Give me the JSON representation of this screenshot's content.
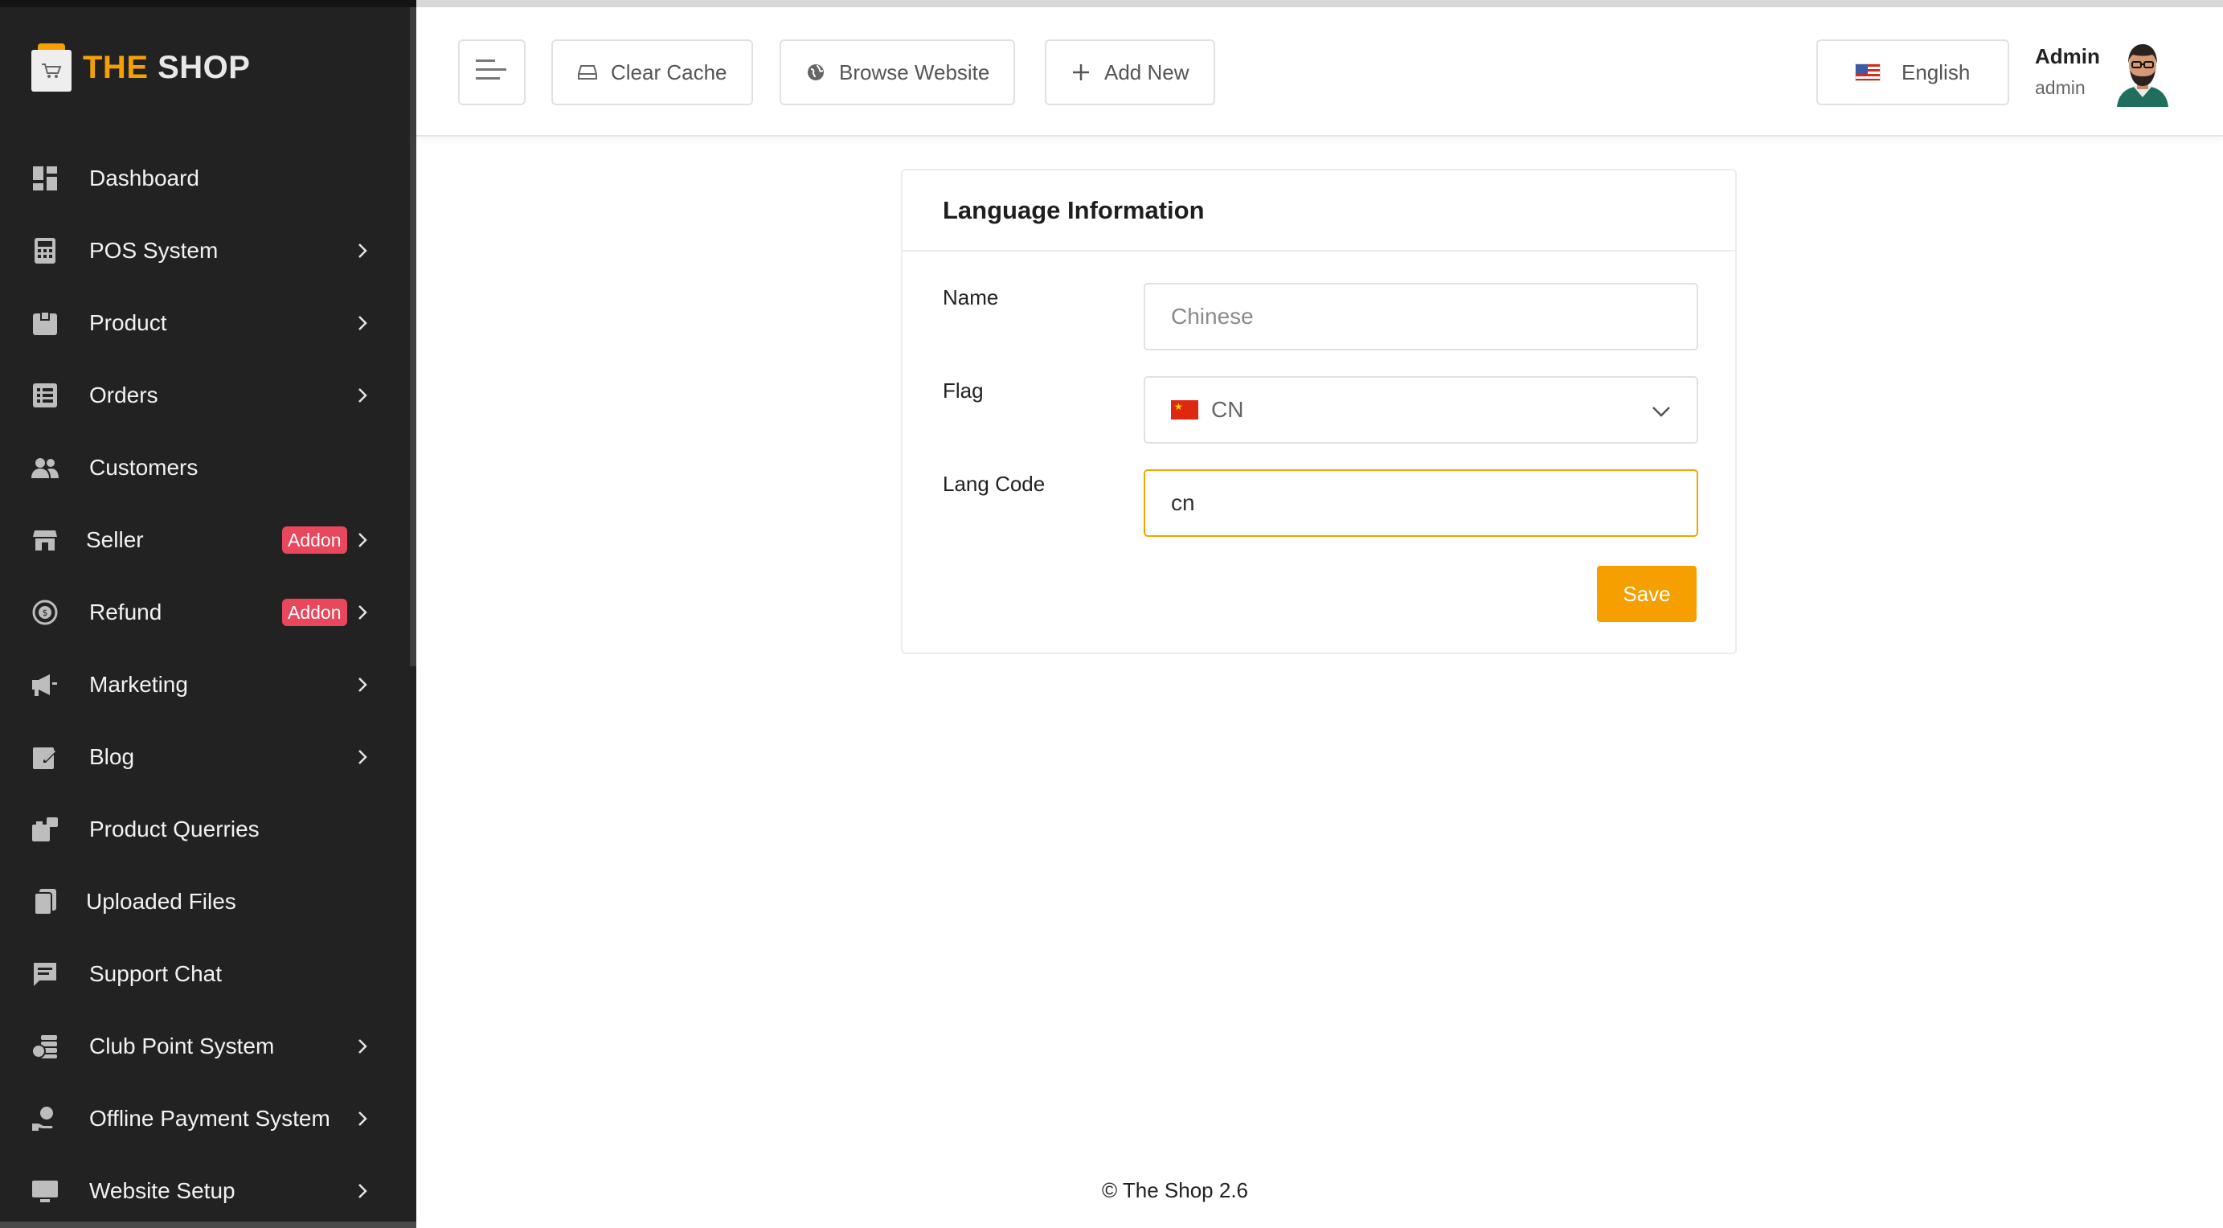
{
  "brand": {
    "part1": "THE",
    "part2": " SHOP"
  },
  "sidebar": {
    "items": [
      {
        "label": "Dashboard",
        "icon": "dashboard-icon",
        "chevron": false
      },
      {
        "label": "POS System",
        "icon": "calculator-icon",
        "chevron": true
      },
      {
        "label": "Product",
        "icon": "product-icon",
        "chevron": true
      },
      {
        "label": "Orders",
        "icon": "list-icon",
        "chevron": true
      },
      {
        "label": "Customers",
        "icon": "users-icon",
        "chevron": false
      },
      {
        "label": "Seller",
        "icon": "store-icon",
        "chevron": true,
        "badge": "Addon"
      },
      {
        "label": "Refund",
        "icon": "refund-icon",
        "chevron": true,
        "badge": "Addon"
      },
      {
        "label": "Marketing",
        "icon": "megaphone-icon",
        "chevron": true
      },
      {
        "label": "Blog",
        "icon": "blog-icon",
        "chevron": true
      },
      {
        "label": "Product Querries",
        "icon": "query-icon",
        "chevron": false
      },
      {
        "label": "Uploaded Files",
        "icon": "files-icon",
        "chevron": false
      },
      {
        "label": "Support Chat",
        "icon": "chat-icon",
        "chevron": false
      },
      {
        "label": "Club Point System",
        "icon": "coins-icon",
        "chevron": true
      },
      {
        "label": "Offline Payment System",
        "icon": "payment-icon",
        "chevron": true
      },
      {
        "label": "Website Setup",
        "icon": "monitor-icon",
        "chevron": true
      }
    ]
  },
  "header": {
    "clear_cache": "Clear Cache",
    "browse_website": "Browse Website",
    "add_new": "Add New",
    "language": "English",
    "user_name": "Admin",
    "user_role": "admin"
  },
  "form": {
    "title": "Language Information",
    "name_label": "Name",
    "name_placeholder": "Chinese",
    "flag_label": "Flag",
    "flag_value": "CN",
    "code_label": "Lang Code",
    "code_value": "cn",
    "save": "Save"
  },
  "footer": {
    "text": "© The Shop 2.6"
  },
  "colors": {
    "accent": "#f5a000",
    "sidebar_bg": "#222222",
    "badge": "#e9475c"
  }
}
